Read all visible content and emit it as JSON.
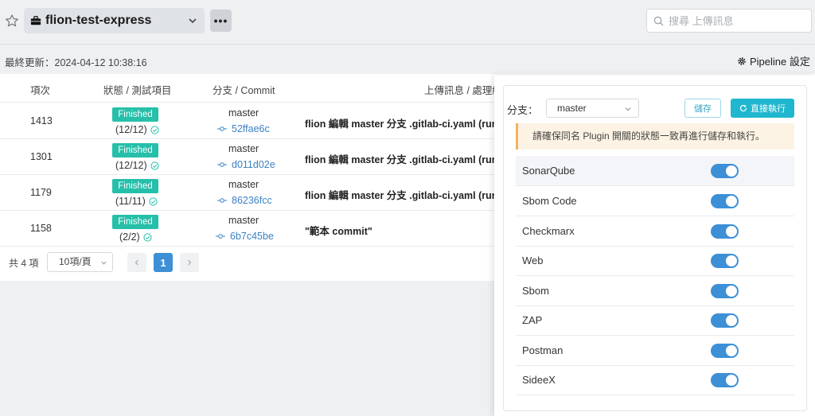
{
  "header": {
    "project_name": "flion-test-express",
    "more_label": "•••",
    "search_placeholder": "搜尋 上傳訊息"
  },
  "status": {
    "last_update": "最終更新：2024-04-12 10:38:16",
    "pipeline_setting_label": "Pipeline 設定"
  },
  "table": {
    "headers": [
      "項次",
      "狀態 / 測試項目",
      "分支 / Commit",
      "上傳訊息 / 處理結"
    ],
    "rows": [
      {
        "id": "1413",
        "status": "Finished",
        "count": "(12/12)",
        "branch": "master",
        "commit": "52ffae6c",
        "message": "flion 編輯 master 分支 .gitlab-ci.yaml (run"
      },
      {
        "id": "1301",
        "status": "Finished",
        "count": "(12/12)",
        "branch": "master",
        "commit": "d011d02e",
        "message": "flion 編輯 master 分支 .gitlab-ci.yaml (run"
      },
      {
        "id": "1179",
        "status": "Finished",
        "count": "(11/11)",
        "branch": "master",
        "commit": "86236fcc",
        "message": "flion 編輯 master 分支 .gitlab-ci.yaml (run"
      },
      {
        "id": "1158",
        "status": "Finished",
        "count": "(2/2)",
        "branch": "master",
        "commit": "6b7c45be",
        "message": "\"範本 commit\""
      }
    ]
  },
  "pager": {
    "total": "共 4 項",
    "page_size": "10項/頁",
    "current_page": "1"
  },
  "panel": {
    "branch_label": "分支：",
    "branch_value": "master",
    "save_label": "儲存",
    "run_label": "直接執行",
    "alert": "請確保同名 Plugin 開關的狀態一致再進行儲存和執行。",
    "plugins": [
      {
        "name": "SonarQube",
        "enabled": true
      },
      {
        "name": "Sbom Code",
        "enabled": true
      },
      {
        "name": "Checkmarx",
        "enabled": true
      },
      {
        "name": "Web",
        "enabled": true
      },
      {
        "name": "Sbom",
        "enabled": true
      },
      {
        "name": "ZAP",
        "enabled": true
      },
      {
        "name": "Postman",
        "enabled": true
      },
      {
        "name": "SideeX",
        "enabled": true
      }
    ]
  },
  "colors": {
    "accent": "#3d8fd6",
    "success": "#26bfa9",
    "warning": "#f4b35e",
    "link": "#3b82c4"
  }
}
